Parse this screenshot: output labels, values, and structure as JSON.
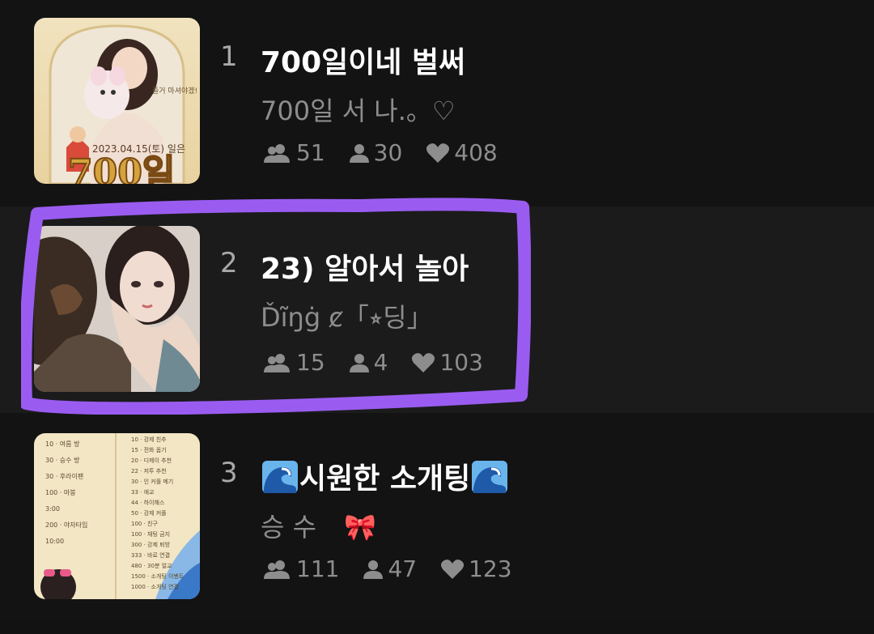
{
  "items": [
    {
      "rank": "1",
      "title": "700일이네 벌써",
      "subtitle": "700일 서 나.。♡",
      "members": "51",
      "users": "30",
      "likes": "408",
      "thumb": {
        "banner_text": "2023.04.15(토) 일은",
        "big_text": "700일",
        "caption": "즐거 마셔야겠!"
      }
    },
    {
      "rank": "2",
      "title": "23) 알아서 놀아",
      "subtitle": "Ďĩŋġ ȼ「⭒딩」",
      "members": "15",
      "users": "4",
      "likes": "103"
    },
    {
      "rank": "3",
      "title_text": "시원한 소개팅",
      "subtitle": "승 수",
      "bow": "🎀",
      "members": "111",
      "users": "47",
      "likes": "123",
      "thumb": {
        "left_lines": [
          "10 · 여름 방",
          "30 · 승수 방",
          "30 · 후라이팬",
          "100 · 마붕",
          "3:00",
          "200 · 야자타임",
          "10:00"
        ],
        "right_lines": [
          "10 · 강제 친추",
          "15 · 전화 옵기",
          "20 · 디제이 추천",
          "22 · 저투 추천",
          "30 · 인 커플 메기",
          "33 · 애교",
          "44 · 하이해스",
          "50 · 강제 커플",
          "100 · 친구",
          "100 · 채팅 금지",
          "300 · 강제 퇴방",
          "333 · 바로 연결",
          "480 · 30분 얼교",
          "1500 · 소개팅 이벤트",
          "1000 · 소개팅 연결"
        ]
      }
    }
  ],
  "colors": {
    "background": "#121212",
    "selected_row": "#1b1b1c",
    "highlight": "#9a5cf0",
    "title": "#ffffff",
    "muted": "#8d8d8d"
  }
}
